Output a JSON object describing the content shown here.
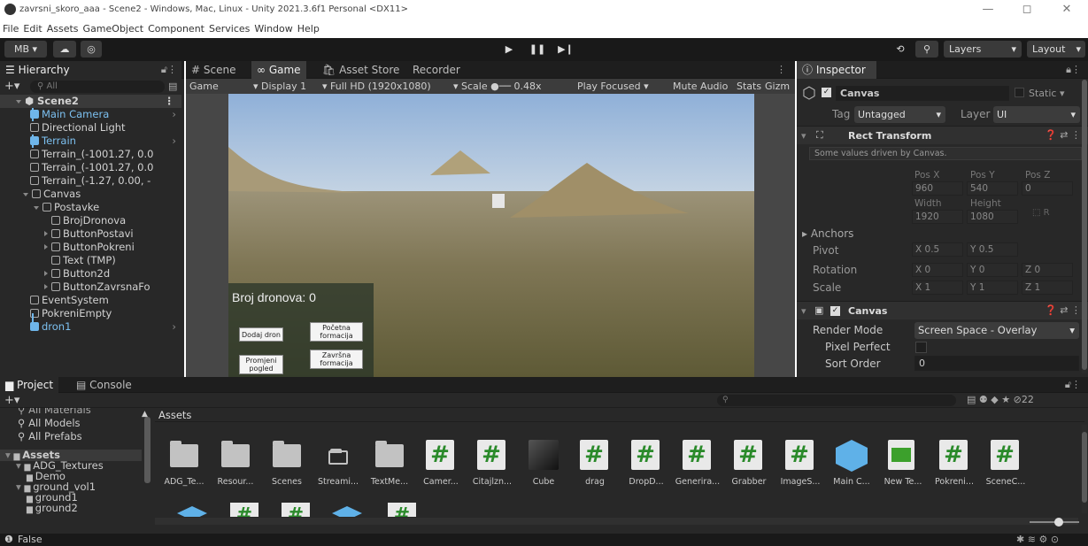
{
  "window": {
    "title": "zavrsni_skoro_aaa - Scene2 - Windows, Mac, Linux - Unity 2021.3.6f1 Personal <DX11>",
    "minimize": "—",
    "maximize": "◻",
    "close": "✕"
  },
  "menu": [
    "File",
    "Edit",
    "Assets",
    "GameObject",
    "Component",
    "Services",
    "Window",
    "Help"
  ],
  "toolbar": {
    "account": "MB ▾",
    "cloud": "☁",
    "collab": "◎",
    "play": "▶",
    "pause": "❚❚",
    "step": "▶❙",
    "history": "⟲",
    "search": "⚲",
    "layers": "Layers",
    "layout": "Layout"
  },
  "hierarchy": {
    "tab": "Hierarchy",
    "search_placeholder": "All",
    "scene": "Scene2",
    "items": [
      {
        "label": "Main Camera",
        "depth": 1,
        "blue": true,
        "expand": "none",
        "arrow": true
      },
      {
        "label": "Directional Light",
        "depth": 1,
        "blue": false,
        "expand": "none",
        "arrow": false
      },
      {
        "label": "Terrain",
        "depth": 1,
        "blue": true,
        "expand": "none",
        "arrow": true
      },
      {
        "label": "Terrain_(-1001.27, 0.0",
        "depth": 1,
        "blue": false,
        "expand": "none",
        "arrow": false
      },
      {
        "label": "Terrain_(-1001.27, 0.0",
        "depth": 1,
        "blue": false,
        "expand": "none",
        "arrow": false
      },
      {
        "label": "Terrain_(-1.27, 0.00, -",
        "depth": 1,
        "blue": false,
        "expand": "none",
        "arrow": false
      },
      {
        "label": "Canvas",
        "depth": 1,
        "blue": false,
        "expand": "open",
        "arrow": false
      },
      {
        "label": "Postavke",
        "depth": 2,
        "blue": false,
        "expand": "open",
        "arrow": false
      },
      {
        "label": "BrojDronova",
        "depth": 3,
        "blue": false,
        "expand": "none",
        "arrow": false
      },
      {
        "label": "ButtonPostavi",
        "depth": 3,
        "blue": false,
        "expand": "closed",
        "arrow": false
      },
      {
        "label": "ButtonPokreni",
        "depth": 3,
        "blue": false,
        "expand": "closed",
        "arrow": false
      },
      {
        "label": "Text (TMP)",
        "depth": 3,
        "blue": false,
        "expand": "none",
        "arrow": false
      },
      {
        "label": "Button2d",
        "depth": 3,
        "blue": false,
        "expand": "closed",
        "arrow": false
      },
      {
        "label": "ButtonZavrsnaFo",
        "depth": 3,
        "blue": false,
        "expand": "closed",
        "arrow": false
      },
      {
        "label": "EventSystem",
        "depth": 1,
        "blue": false,
        "expand": "none",
        "arrow": false
      },
      {
        "label": "PokreniEmpty",
        "depth": 1,
        "blue": false,
        "expand": "none",
        "arrow": false
      },
      {
        "label": "dron1",
        "depth": 1,
        "blue": true,
        "expand": "none",
        "arrow": true
      }
    ]
  },
  "center_tabs": {
    "scene": "Scene",
    "game": "Game",
    "store": "Asset Store",
    "recorder": "Recorder"
  },
  "game_bar": {
    "view": "Game",
    "display": "Display 1",
    "resolution": "Full HD (1920x1080)",
    "scale_label": "Scale",
    "scale_value": "0.48x",
    "play_focused": "Play Focused",
    "mute": "Mute Audio",
    "stats": "Stats",
    "gizmos": "Gizm"
  },
  "game_ui": {
    "count_label": "Broj dronova: 0",
    "btn_add": "Dodaj dron",
    "btn_start": "Početna formacija",
    "btn_change": "Promjeni pogled",
    "btn_final": "Završna formacija"
  },
  "inspector": {
    "tab": "Inspector",
    "object_name": "Canvas",
    "static": "Static",
    "tag_label": "Tag",
    "tag_value": "Untagged",
    "layer_label": "Layer",
    "layer_value": "UI",
    "rect_title": "Rect Transform",
    "driven_note": "Some values driven by Canvas.",
    "posx_label": "Pos X",
    "posy_label": "Pos Y",
    "posz_label": "Pos Z",
    "posx": "960",
    "posy": "540",
    "posz": "0",
    "width_label": "Width",
    "height_label": "Height",
    "width": "1920",
    "height": "1080",
    "anchors": "Anchors",
    "pivot_label": "Pivot",
    "pivot_x": "X  0.5",
    "pivot_y": "Y  0.5",
    "rotation_label": "Rotation",
    "rot_x": "X  0",
    "rot_y": "Y  0",
    "rot_z": "Z  0",
    "scale_label": "Scale",
    "scale_x": "X  1",
    "scale_y": "Y  1",
    "scale_z": "Z  1",
    "canvas_title": "Canvas",
    "render_mode_label": "Render Mode",
    "render_mode": "Screen Space - Overlay",
    "pixel_perfect_label": "Pixel Perfect",
    "sort_order_label": "Sort Order",
    "sort_order": "0"
  },
  "bottom_tabs": {
    "project": "Project",
    "console": "Console"
  },
  "project": {
    "favorites": [
      "All Materials",
      "All Models",
      "All Prefabs"
    ],
    "tree": [
      {
        "label": "Assets",
        "depth": 0,
        "open": true
      },
      {
        "label": "ADG_Textures",
        "depth": 1,
        "open": true
      },
      {
        "label": "Demo",
        "depth": 2,
        "open": false
      },
      {
        "label": "ground_vol1",
        "depth": 1,
        "open": true
      },
      {
        "label": "ground1",
        "depth": 2,
        "open": false
      },
      {
        "label": "ground2",
        "depth": 2,
        "open": false
      }
    ],
    "breadcrumb": "Assets",
    "hidden_count": "22",
    "assets": [
      {
        "label": "ADG_Te...",
        "kind": "folder"
      },
      {
        "label": "Resour...",
        "kind": "folder"
      },
      {
        "label": "Scenes",
        "kind": "folder"
      },
      {
        "label": "Streami...",
        "kind": "emptyfolder"
      },
      {
        "label": "TextMe...",
        "kind": "folder"
      },
      {
        "label": "Camer...",
        "kind": "script"
      },
      {
        "label": "Citajlzn...",
        "kind": "script"
      },
      {
        "label": "Cube",
        "kind": "cube"
      },
      {
        "label": "drag",
        "kind": "script"
      },
      {
        "label": "DropD...",
        "kind": "script"
      },
      {
        "label": "Generira...",
        "kind": "script"
      },
      {
        "label": "Grabber",
        "kind": "script"
      },
      {
        "label": "ImageS...",
        "kind": "script"
      },
      {
        "label": "Main C...",
        "kind": "prefab"
      },
      {
        "label": "New Te...",
        "kind": "terrain"
      },
      {
        "label": "Pokreni...",
        "kind": "script"
      },
      {
        "label": "SceneC...",
        "kind": "script"
      }
    ]
  },
  "status": {
    "text": "False"
  },
  "colors": {
    "accent": "#6fb6ea",
    "panel": "#282828",
    "toolbar": "#191919",
    "script_green": "#2a8a2a"
  }
}
